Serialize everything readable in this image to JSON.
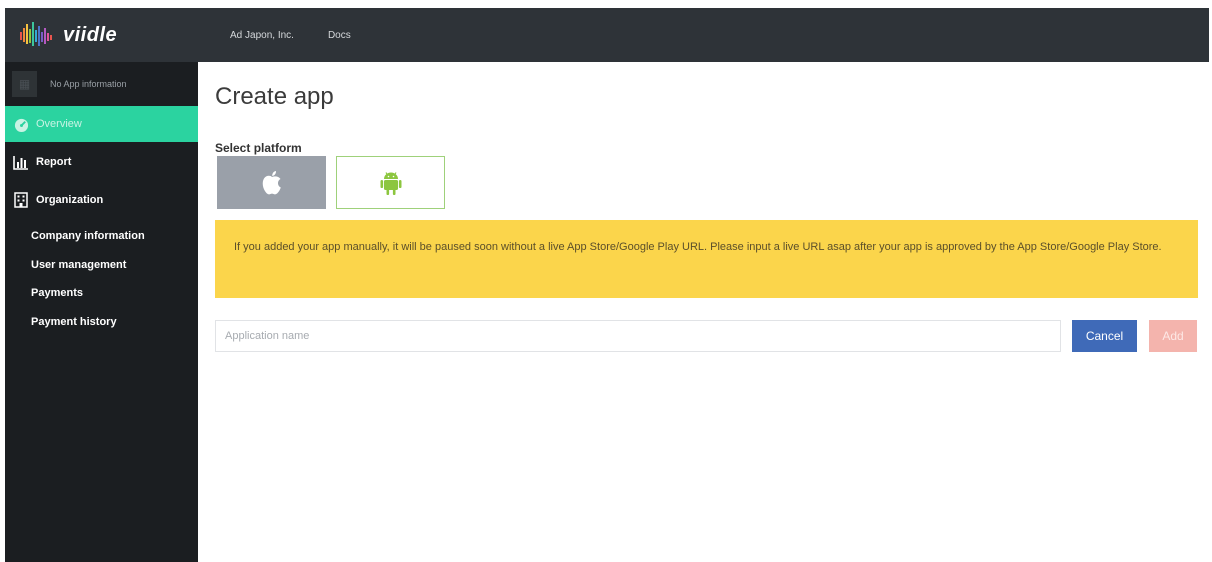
{
  "brand": {
    "name": "viidle"
  },
  "topnav": {
    "company": "Ad Japon, Inc.",
    "docs": "Docs"
  },
  "sidebar": {
    "app_info": "No App information",
    "items": [
      {
        "label": "Overview",
        "icon": "dashboard-icon",
        "active": true
      },
      {
        "label": "Report",
        "icon": "bar-chart-icon"
      },
      {
        "label": "Organization",
        "icon": "building-icon"
      }
    ],
    "sub_items": [
      "Company information",
      "User management",
      "Payments",
      "Payment history"
    ],
    "collapse_icon": "‹"
  },
  "main": {
    "title": "Create app",
    "platform_label": "Select platform",
    "platforms": [
      "apple-icon",
      "android-icon"
    ],
    "alert": "If you added your app manually, it will be paused soon without a live App Store/Google Play URL. Please input a live URL asap after your app is approved by the App Store/Google Play Store.",
    "input_placeholder": "Application name",
    "cancel_label": "Cancel",
    "add_label": "Add"
  },
  "colors": {
    "topbar": "#2e3338",
    "sidebar": "#1b1e21",
    "active": "#2bd3a0",
    "alert": "#fbd54b",
    "cancel": "#3f6ab8",
    "add": "#f4b4ad",
    "android": "#8cc63f"
  }
}
